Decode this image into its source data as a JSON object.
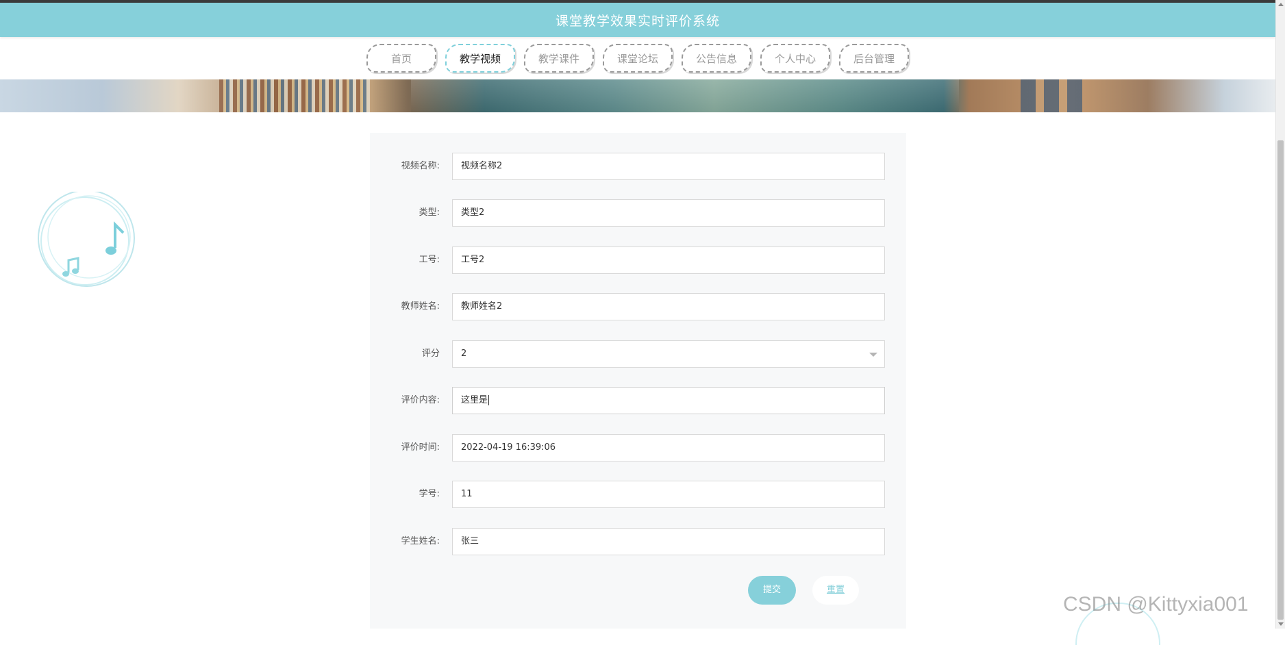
{
  "app": {
    "title": "课堂教学效果实时评价系统"
  },
  "nav": {
    "tabs": [
      {
        "label": "首页",
        "active": false
      },
      {
        "label": "教学视频",
        "active": true
      },
      {
        "label": "教学课件",
        "active": false
      },
      {
        "label": "课堂论坛",
        "active": false
      },
      {
        "label": "公告信息",
        "active": false
      },
      {
        "label": "个人中心",
        "active": false
      },
      {
        "label": "后台管理",
        "active": false
      }
    ]
  },
  "form": {
    "fields": [
      {
        "label": "视频名称:",
        "value": "视频名称2",
        "type": "text"
      },
      {
        "label": "类型:",
        "value": "类型2",
        "type": "text"
      },
      {
        "label": "工号:",
        "value": "工号2",
        "type": "text"
      },
      {
        "label": "教师姓名:",
        "value": "教师姓名2",
        "type": "text"
      },
      {
        "label": "评分",
        "value": "2",
        "type": "select"
      },
      {
        "label": "评价内容:",
        "value": "这里是",
        "type": "text",
        "focused": true
      },
      {
        "label": "评价时间:",
        "value": "2022-04-19 16:39:06",
        "type": "text"
      },
      {
        "label": "学号:",
        "value": "11",
        "type": "text"
      },
      {
        "label": "学生姓名:",
        "value": "张三",
        "type": "text"
      }
    ],
    "submit_label": "提交",
    "reset_label": "重置"
  },
  "watermark": "CSDN @Kittyxia001",
  "colors": {
    "accent": "#86d0da",
    "panel": "#f7f8f9",
    "border": "#d9d9d9"
  }
}
